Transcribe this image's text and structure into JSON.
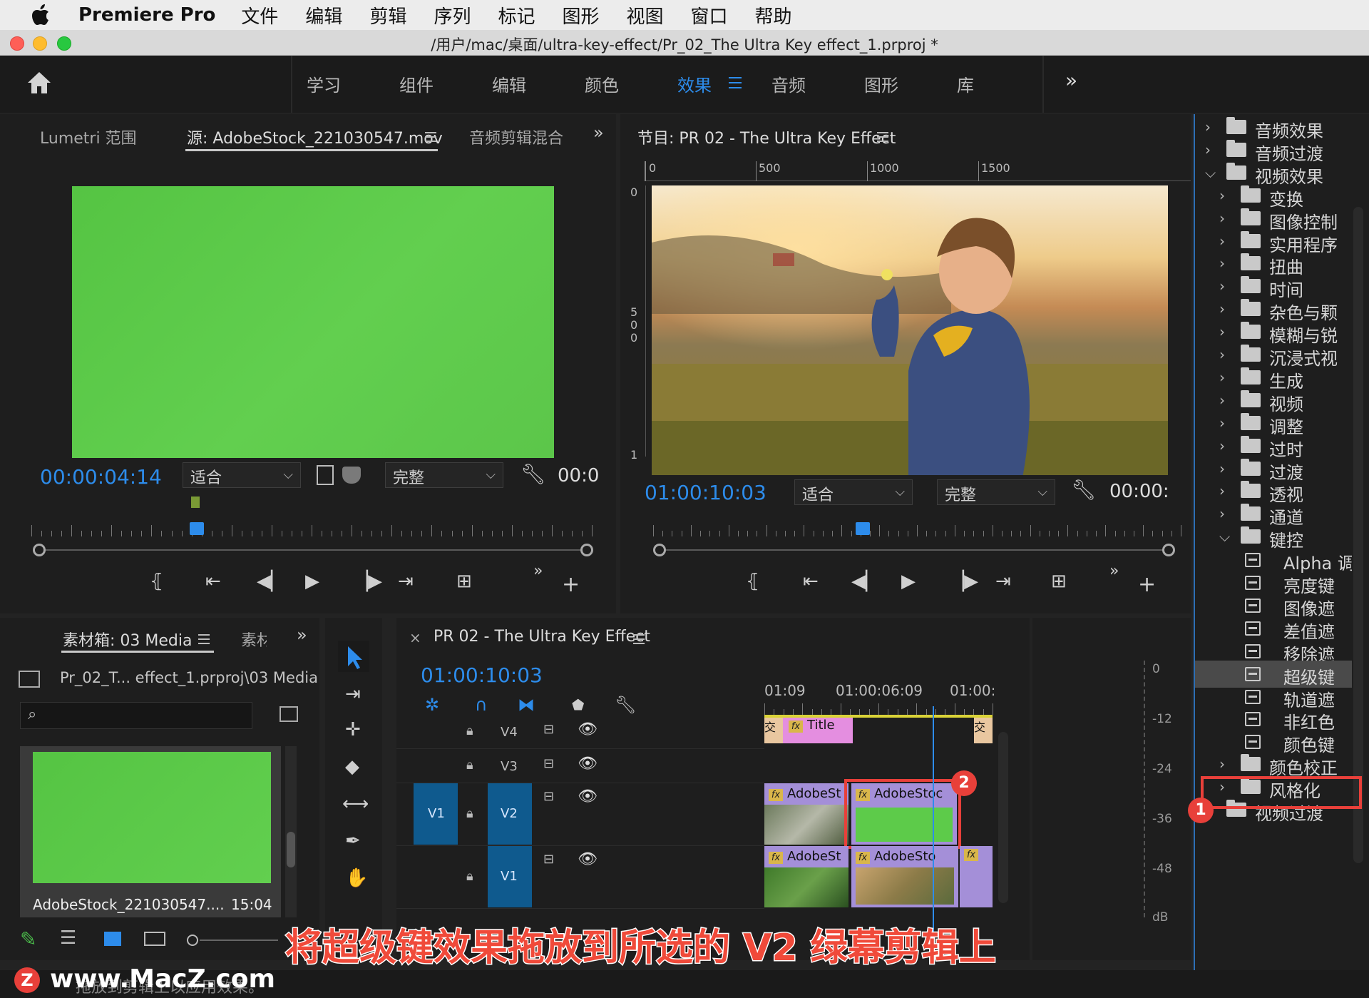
{
  "menubar": {
    "app_name": "Premiere Pro",
    "items": [
      "文件",
      "编辑",
      "剪辑",
      "序列",
      "标记",
      "图形",
      "视图",
      "窗口",
      "帮助"
    ]
  },
  "window": {
    "title": "/用户/mac/桌面/ultra-key-effect/Pr_02_The Ultra Key effect_1.prproj *"
  },
  "workspaces": {
    "items": [
      "学习",
      "组件",
      "编辑",
      "颜色",
      "效果",
      "音频",
      "图形",
      "库"
    ],
    "active": "效果",
    "overflow": "»"
  },
  "source_monitor": {
    "tabs": [
      "Lumetri 范围",
      "源: AdobeStock_221030547.mov",
      "音频剪辑混合"
    ],
    "active_tab": "源: AdobeStock_221030547.mov",
    "timecode": "00:00:04:14",
    "zoom": "适合",
    "quality": "完整",
    "end_timecode": "00:0",
    "playhead": 0.295
  },
  "program_monitor": {
    "title": "节目: PR 02 - The Ultra Key Effect",
    "ruler_labels": [
      "0",
      "500",
      "1000",
      "1500"
    ],
    "vertical_ruler_labels": [
      "0",
      "5",
      "0",
      "0",
      "1"
    ],
    "timecode": "01:00:10:03",
    "zoom": "适合",
    "quality": "完整",
    "end_timecode": "00:00:",
    "playhead": 0.397
  },
  "project_panel": {
    "tabs": [
      "素材箱: 03 Media",
      "素材"
    ],
    "path": "Pr_02_T... effect_1.prproj\\03 Media",
    "thumb_name": "AdobeStock_221030547....",
    "thumb_duration": "15:04"
  },
  "timeline": {
    "title": "PR 02 - The Ultra Key Effect",
    "timecode": "01:00:10:03",
    "ruler_labels": [
      "01:09",
      "01:00:06:09",
      "01:00:"
    ],
    "tracks": [
      {
        "name": "V4",
        "src": ""
      },
      {
        "name": "V3",
        "src": ""
      },
      {
        "name": "V2",
        "src": "V1"
      },
      {
        "name": "V1",
        "src": ""
      }
    ],
    "clips": {
      "title_clip": "Title",
      "v2_a": "AdobeSt",
      "v2_b": "AdobeStoc",
      "v1_a": "AdobeSt",
      "v1_b": "AdobeSto",
      "transition": "交"
    }
  },
  "audio_meter": {
    "labels": [
      "0",
      "-12",
      "-24",
      "-36",
      "-48",
      "dB"
    ]
  },
  "effects_tree": {
    "items": [
      {
        "label": "音频效果",
        "level": 0,
        "type": "folder",
        "open": false
      },
      {
        "label": "音频过渡",
        "level": 0,
        "type": "folder",
        "open": false
      },
      {
        "label": "视频效果",
        "level": 0,
        "type": "folder",
        "open": true
      },
      {
        "label": "变换",
        "level": 1,
        "type": "folder",
        "open": false
      },
      {
        "label": "图像控制",
        "level": 1,
        "type": "folder",
        "open": false
      },
      {
        "label": "实用程序",
        "level": 1,
        "type": "folder",
        "open": false
      },
      {
        "label": "扭曲",
        "level": 1,
        "type": "folder",
        "open": false
      },
      {
        "label": "时间",
        "level": 1,
        "type": "folder",
        "open": false
      },
      {
        "label": "杂色与颗",
        "level": 1,
        "type": "folder",
        "open": false
      },
      {
        "label": "模糊与锐",
        "level": 1,
        "type": "folder",
        "open": false
      },
      {
        "label": "沉浸式视",
        "level": 1,
        "type": "folder",
        "open": false
      },
      {
        "label": "生成",
        "level": 1,
        "type": "folder",
        "open": false
      },
      {
        "label": "视频",
        "level": 1,
        "type": "folder",
        "open": false
      },
      {
        "label": "调整",
        "level": 1,
        "type": "folder",
        "open": false
      },
      {
        "label": "过时",
        "level": 1,
        "type": "folder",
        "open": false
      },
      {
        "label": "过渡",
        "level": 1,
        "type": "folder",
        "open": false
      },
      {
        "label": "透视",
        "level": 1,
        "type": "folder",
        "open": false
      },
      {
        "label": "通道",
        "level": 1,
        "type": "folder",
        "open": false
      },
      {
        "label": "键控",
        "level": 1,
        "type": "folder",
        "open": true
      },
      {
        "label": "Alpha 调",
        "level": 2,
        "type": "effect"
      },
      {
        "label": "亮度键",
        "level": 2,
        "type": "effect"
      },
      {
        "label": "图像遮",
        "level": 2,
        "type": "effect"
      },
      {
        "label": "差值遮",
        "level": 2,
        "type": "effect"
      },
      {
        "label": "移除遮",
        "level": 2,
        "type": "effect"
      },
      {
        "label": "超级键",
        "level": 2,
        "type": "effect",
        "selected": true
      },
      {
        "label": "轨道遮",
        "level": 2,
        "type": "effect"
      },
      {
        "label": "非红色",
        "level": 2,
        "type": "effect"
      },
      {
        "label": "颜色键",
        "level": 2,
        "type": "effect"
      },
      {
        "label": "颜色校正",
        "level": 1,
        "type": "folder",
        "open": false
      },
      {
        "label": "风格化",
        "level": 1,
        "type": "folder",
        "open": false
      },
      {
        "label": "视频过渡",
        "level": 0,
        "type": "folder",
        "open": false
      }
    ]
  },
  "annotations": {
    "badge_1": "1",
    "badge_2": "2",
    "caption": "将超级键效果拖放到所选的 V2 绿幕剪辑上",
    "watermark": "www.MacZ.com",
    "status_text": "拖放到剪辑上以应用效果。"
  },
  "colors": {
    "accent": "#2d8ceb",
    "green_screen": "#5dcb4a",
    "annotation_red": "#e8403a",
    "clip_purple": "#a48fd8",
    "clip_pink": "#e48ee0"
  }
}
